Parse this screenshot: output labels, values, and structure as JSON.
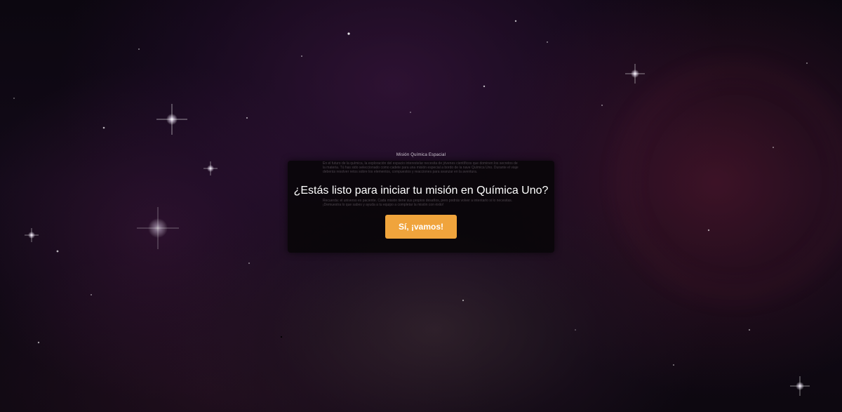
{
  "mission": {
    "subtitle": "Misión Química Espacial",
    "paragraph_1": "En el futuro de la química, la exploración del espacio interestelar necesita de jóvenes científicos que dominen los secretos de la materia. Tú has sido seleccionado como cadete para una misión especial a bordo de la nave Química Uno. Durante el viaje deberás resolver retos sobre los elementos, compuestos y reacciones para avanzar en la aventura.",
    "paragraph_2": "Recuerda: el universo es paciente. Cada misión tiene sus propios desafíos, pero podrás volver a intentarlo si lo necesitas. ¡Demuestra lo que sabes y ayuda a tu equipo a completar la misión con éxito!",
    "question": "¿Estás listo para iniciar tu misión en Química Uno?",
    "confirm_label": "Sí, ¡vamos!"
  },
  "colors": {
    "button_accent": "#f0a43c",
    "dialog_bg": "#080608",
    "text": "#ffffff"
  }
}
